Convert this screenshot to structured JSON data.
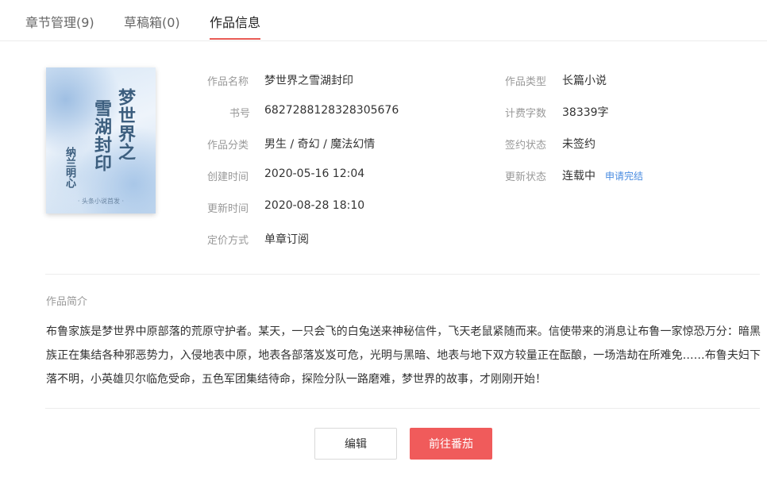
{
  "tabs": [
    {
      "label": "章节管理(9)",
      "active": false
    },
    {
      "label": "草稿箱(0)",
      "active": false
    },
    {
      "label": "作品信息",
      "active": true
    }
  ],
  "cover": {
    "title_line1": "梦世界之",
    "title_line2": "雪湖封印",
    "author": "纳兰明心",
    "publisher": "· 头条小说首发 ·"
  },
  "info_left": [
    {
      "label": "作品名称",
      "value": "梦世界之雪湖封印"
    },
    {
      "label": "书号",
      "value": "6827288128328305676"
    },
    {
      "label": "作品分类",
      "value": "男生 / 奇幻 / 魔法幻情"
    },
    {
      "label": "创建时间",
      "value": "2020-05-16 12:04"
    },
    {
      "label": "更新时间",
      "value": "2020-08-28 18:10"
    },
    {
      "label": "定价方式",
      "value": "单章订阅"
    }
  ],
  "info_right": [
    {
      "label": "作品类型",
      "value": "长篇小说"
    },
    {
      "label": "计费字数",
      "value": "38339字"
    },
    {
      "label": "签约状态",
      "value": "未签约"
    },
    {
      "label": "更新状态",
      "value": "连载中",
      "action": "申请完结"
    }
  ],
  "synopsis": {
    "label": "作品简介",
    "text": "布鲁家族是梦世界中原部落的荒原守护者。某天，一只会飞的白兔送来神秘信件，飞天老鼠紧随而来。信使带来的消息让布鲁一家惊恐万分：暗黑族正在集结各种邪恶势力，入侵地表中原，地表各部落岌岌可危，光明与黑暗、地表与地下双方较量正在酝酿，一场浩劫在所难免……布鲁夫妇下落不明，小英雄贝尔临危受命，五色军团集结待命，探险分队一路磨难，梦世界的故事，才刚刚开始！"
  },
  "buttons": {
    "edit": "编辑",
    "go": "前往番茄"
  },
  "colors": {
    "accent": "#f05b5b",
    "link": "#4a8ce0",
    "tab_underline": "#e95b55"
  }
}
